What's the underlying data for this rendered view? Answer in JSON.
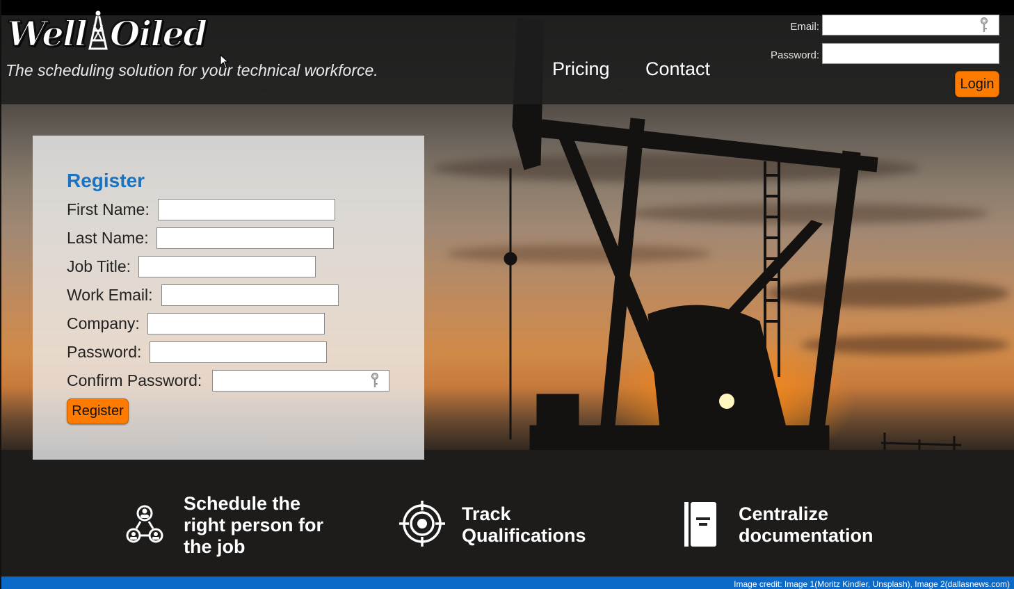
{
  "brand": {
    "logo_text_left": "Well",
    "logo_text_right": "Oiled",
    "tagline": "The scheduling solution for your technical workforce."
  },
  "nav": {
    "items": [
      {
        "label": "Pricing"
      },
      {
        "label": "Contact"
      }
    ]
  },
  "login": {
    "email_label": "Email:",
    "email_value": "",
    "password_label": "Password:",
    "password_value": "",
    "button_label": "Login"
  },
  "register": {
    "title": "Register",
    "fields": [
      {
        "label": "First Name:",
        "value": ""
      },
      {
        "label": "Last Name:",
        "value": ""
      },
      {
        "label": "Job Title:",
        "value": ""
      },
      {
        "label": "Work Email:",
        "value": ""
      },
      {
        "label": "Company:",
        "value": ""
      },
      {
        "label": "Password:",
        "value": ""
      },
      {
        "label": "Confirm Password:",
        "value": ""
      }
    ],
    "button_label": "Register"
  },
  "features": [
    {
      "icon": "team-hierarchy-icon",
      "line1": "Schedule the",
      "line2": "right person for",
      "line3": "the job"
    },
    {
      "icon": "target-icon",
      "line1": "Track",
      "line2": "Qualifications"
    },
    {
      "icon": "document-icon",
      "line1": "Centralize",
      "line2": "documentation"
    }
  ],
  "footer": {
    "credit": "Image credit: Image 1(Moritz Kindler, Unsplash), Image 2(dallasnews.com)"
  },
  "colors": {
    "accent_orange": "#ff7b00",
    "brand_blue": "#1a73c1",
    "footer_blue": "#0b69c7"
  }
}
